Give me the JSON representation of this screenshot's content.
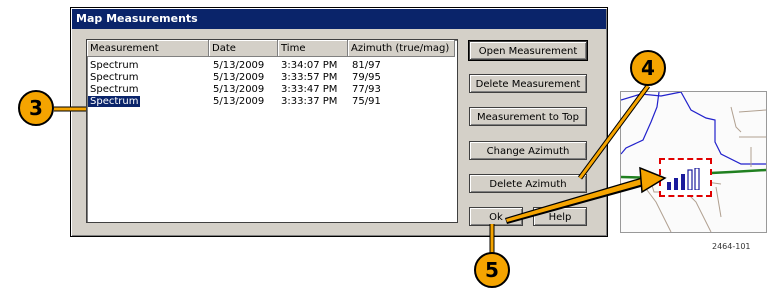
{
  "dialog": {
    "title": "Map Measurements"
  },
  "table": {
    "columns": [
      "Measurement",
      "Date",
      "Time",
      "Azimuth (true/mag)"
    ],
    "rows": [
      [
        "Spectrum",
        "5/13/2009",
        "3:34:07 PM",
        "81/97"
      ],
      [
        "Spectrum",
        "5/13/2009",
        "3:33:57 PM",
        "79/95"
      ],
      [
        "Spectrum",
        "5/13/2009",
        "3:33:47 PM",
        "77/93"
      ],
      [
        "Spectrum",
        "5/13/2009",
        "3:33:37 PM",
        "75/91"
      ]
    ],
    "selected_row": 3
  },
  "buttons": {
    "open": "Open Measurement",
    "delete": "Delete Measurement",
    "to_top": "Measurement to Top",
    "change_azimuth": "Change Azimuth",
    "delete_azimuth": "Delete Azimuth",
    "ok": "Ok",
    "help": "Help"
  },
  "callouts": [
    "3",
    "4",
    "5"
  ],
  "figure_number": "2464-101",
  "colors": {
    "callout": "#f5a400",
    "title_bar": "#0a246a",
    "selection": "#0a246a",
    "marker_border": "#e00000",
    "marker_bars": "#1a1a9c"
  },
  "icons": [
    "signal-strength-icon"
  ]
}
